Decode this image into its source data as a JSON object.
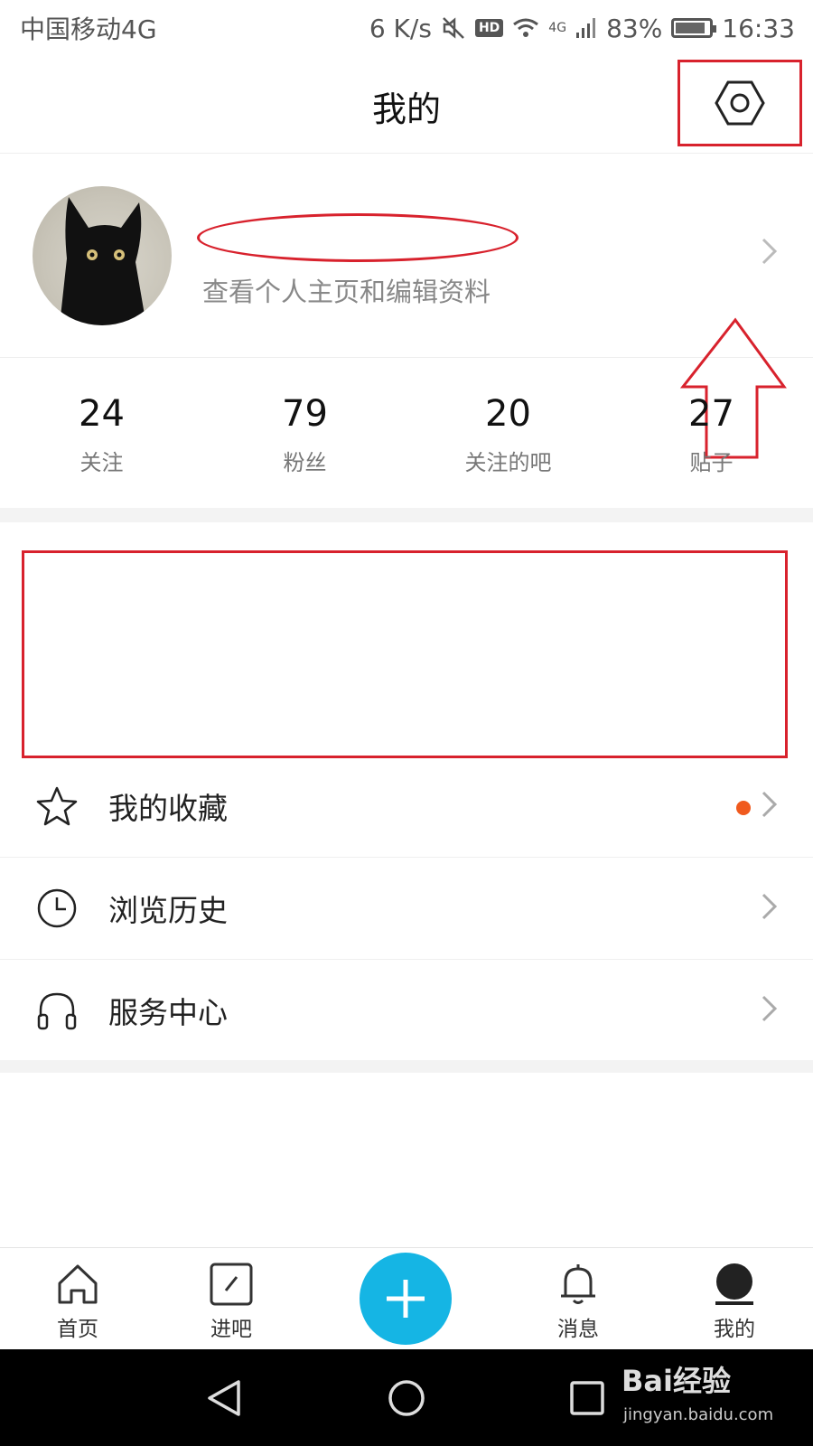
{
  "status_bar": {
    "carrier": "中国移动4G",
    "speed": "6 K/s",
    "hd": "HD",
    "network": "4G",
    "battery": "83%",
    "time": "16:33"
  },
  "header": {
    "title": "我的"
  },
  "profile": {
    "subtitle": "查看个人主页和编辑资料"
  },
  "stats": [
    {
      "value": "24",
      "label": "关注"
    },
    {
      "value": "79",
      "label": "粉丝"
    },
    {
      "value": "20",
      "label": "关注的吧"
    },
    {
      "value": "27",
      "label": "贴子"
    }
  ],
  "menu": [
    {
      "label": "我的收藏",
      "icon": "star-icon",
      "has_dot": true
    },
    {
      "label": "浏览历史",
      "icon": "clock-icon",
      "has_dot": false
    },
    {
      "label": "服务中心",
      "icon": "headphones-icon",
      "has_dot": false
    }
  ],
  "tabs": [
    {
      "label": "首页",
      "icon": "home-icon"
    },
    {
      "label": "进吧",
      "icon": "edit-square-icon"
    },
    {
      "label": "消息",
      "icon": "bell-icon"
    },
    {
      "label": "我的",
      "icon": "user-icon",
      "active": true
    }
  ],
  "watermark": {
    "brand": "Bai经验",
    "url": "jingyan.baidu.com"
  },
  "colors": {
    "accent": "#15b5e4",
    "annotation": "#d8222d",
    "dot": "#f05a1e"
  }
}
